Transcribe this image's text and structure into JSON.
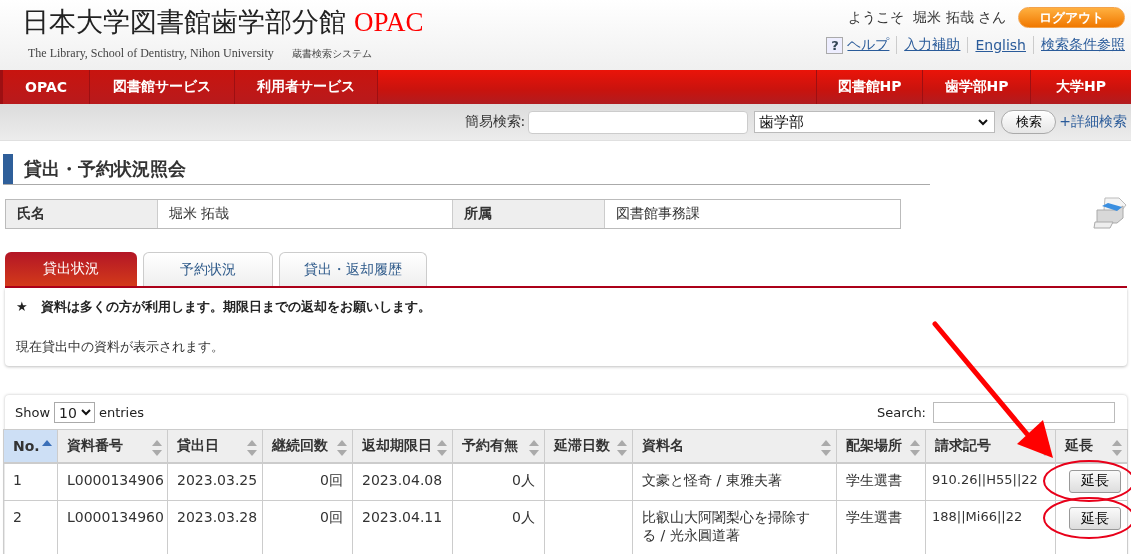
{
  "header": {
    "title": "日本大学図書館歯学部分館",
    "title_accent": "OPAC",
    "subtitle": "The Library, School of Dentistry, Nihon University",
    "system_name": "蔵書検索システム",
    "welcome": "ようこそ  堀米 拓哉 さん",
    "logout": "ログアウト",
    "help_icon": "?",
    "links": [
      "ヘルプ",
      "入力補助",
      "English",
      "検索条件参照"
    ]
  },
  "nav": {
    "left": [
      "OPAC",
      "図書館サービス",
      "利用者サービス"
    ],
    "right": [
      "図書館HP",
      "歯学部HP",
      "大学HP"
    ]
  },
  "quick_search": {
    "label": "簡易検索:",
    "select_value": "歯学部",
    "button": "検索",
    "advanced_link": "+詳細検索"
  },
  "page_title": "貸出・予約状況照会",
  "profile": [
    {
      "label": "氏名",
      "value": "堀米 拓哉"
    },
    {
      "label": "所属",
      "value": "図書館事務課"
    }
  ],
  "tabs": [
    {
      "label": "貸出状況",
      "selected": true
    },
    {
      "label": "予約状況",
      "selected": false
    },
    {
      "label": "貸出・返却履歴",
      "selected": false
    }
  ],
  "notice_mark": "★",
  "notice": "資料は多くの方が利用します。期限日までの返却をお願いします。",
  "info": "現在貸出中の資料が表示されます。",
  "table": {
    "show_label": "Show",
    "page_length": "10",
    "entries_label": "entries",
    "search_label": "Search:",
    "columns": [
      {
        "label": "No.",
        "sorted": true
      },
      {
        "label": "資料番号",
        "sorted": false
      },
      {
        "label": "貸出日",
        "sorted": false
      },
      {
        "label": "継続回数",
        "sorted": false
      },
      {
        "label": "返却期限日",
        "sorted": false
      },
      {
        "label": "予約有無",
        "sorted": false
      },
      {
        "label": "延滞日数",
        "sorted": false
      },
      {
        "label": "資料名",
        "sorted": false
      },
      {
        "label": "配架場所",
        "sorted": false
      },
      {
        "label": "請求記号",
        "sorted": false
      },
      {
        "label": "延長",
        "sorted": false
      }
    ],
    "rows": [
      {
        "cells": [
          "1",
          "L0000134906",
          "2023.03.25",
          "0回",
          "2023.04.08",
          "0人",
          "",
          "文豪と怪奇 / 東雅夫著",
          "学生選書",
          "910.26||H55||22"
        ],
        "action": "延長",
        "circled": true
      },
      {
        "cells": [
          "2",
          "L0000134960",
          "2023.03.28",
          "0回",
          "2023.04.11",
          "0人",
          "",
          "比叡山大阿闍梨心を掃除する / 光永圓道著",
          "学生選書",
          "188||Mi66||22"
        ],
        "action": "延長",
        "circled": true
      }
    ]
  },
  "arrow_annotation": true
}
